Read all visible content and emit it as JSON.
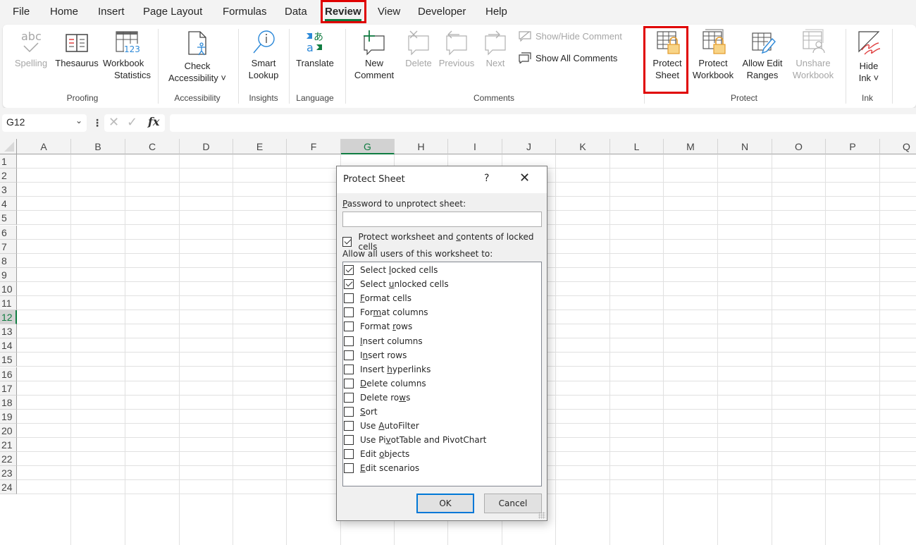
{
  "menu": {
    "tabs": [
      "File",
      "Home",
      "Insert",
      "Page Layout",
      "Formulas",
      "Data",
      "Review",
      "View",
      "Developer",
      "Help"
    ],
    "active_tab": "Review"
  },
  "ribbon": {
    "groups": {
      "proofing": "Proofing",
      "accessibility": "Accessibility",
      "insights": "Insights",
      "language": "Language",
      "comments": "Comments",
      "protect": "Protect",
      "ink": "Ink"
    },
    "buttons": {
      "spelling": "Spelling",
      "thesaurus": "Thesaurus",
      "workbook_statistics_1": "Workbook",
      "workbook_statistics_2": "Statistics",
      "check_accessibility_1": "Check",
      "check_accessibility_2": "Accessibility ˅",
      "smart_lookup_1": "Smart",
      "smart_lookup_2": "Lookup",
      "translate": "Translate",
      "new_comment_1": "New",
      "new_comment_2": "Comment",
      "delete": "Delete",
      "previous": "Previous",
      "next": "Next",
      "show_hide_comment": "Show/Hide Comment",
      "show_all_comments": "Show All Comments",
      "protect_sheet_1": "Protect",
      "protect_sheet_2": "Sheet",
      "protect_workbook_1": "Protect",
      "protect_workbook_2": "Workbook",
      "allow_edit_ranges_1": "Allow Edit",
      "allow_edit_ranges_2": "Ranges",
      "unshare_workbook_1": "Unshare",
      "unshare_workbook_2": "Workbook",
      "hide_ink_1": "Hide",
      "hide_ink_2": "Ink ˅"
    },
    "icons": {
      "abc": "abc",
      "fx": "fx",
      "stats_num": "123"
    }
  },
  "formula_bar": {
    "name_box": "G12",
    "formula": ""
  },
  "sheet": {
    "columns": [
      "A",
      "B",
      "C",
      "D",
      "E",
      "F",
      "G",
      "H",
      "I",
      "J",
      "K",
      "L",
      "M",
      "N",
      "O",
      "P",
      "Q"
    ],
    "rows": [
      "1",
      "2",
      "3",
      "4",
      "5",
      "6",
      "7",
      "8",
      "9",
      "10",
      "11",
      "12",
      "13",
      "14",
      "15",
      "16",
      "17",
      "18",
      "19",
      "20",
      "21",
      "22",
      "23",
      "24"
    ],
    "selected_column": "G",
    "selected_row": "12"
  },
  "dialog": {
    "title": "Protect Sheet",
    "help": "?",
    "close": "✕",
    "password_label_u": "P",
    "password_label_rest": "assword to unprotect sheet:",
    "password_value": "",
    "protect_contents_pre": "Protect worksheet and ",
    "protect_contents_u": "c",
    "protect_contents_post": "ontents of locked cells",
    "protect_contents_checked": true,
    "allow_label": "Allow all users of this worksheet to:",
    "permissions": [
      {
        "pre": "Select ",
        "u": "l",
        "post": "ocked cells",
        "checked": true
      },
      {
        "pre": "Select ",
        "u": "u",
        "post": "nlocked cells",
        "checked": true
      },
      {
        "pre": "",
        "u": "F",
        "post": "ormat cells",
        "checked": false
      },
      {
        "pre": "For",
        "u": "m",
        "post": "at columns",
        "checked": false
      },
      {
        "pre": "Format ",
        "u": "r",
        "post": "ows",
        "checked": false
      },
      {
        "pre": "",
        "u": "I",
        "post": "nsert columns",
        "checked": false
      },
      {
        "pre": "I",
        "u": "n",
        "post": "sert rows",
        "checked": false
      },
      {
        "pre": "Insert ",
        "u": "h",
        "post": "yperlinks",
        "checked": false
      },
      {
        "pre": "",
        "u": "D",
        "post": "elete columns",
        "checked": false
      },
      {
        "pre": "Delete ro",
        "u": "w",
        "post": "s",
        "checked": false
      },
      {
        "pre": "",
        "u": "S",
        "post": "ort",
        "checked": false
      },
      {
        "pre": "Use ",
        "u": "A",
        "post": "utoFilter",
        "checked": false
      },
      {
        "pre": "Use Pi",
        "u": "v",
        "post": "otTable and PivotChart",
        "checked": false
      },
      {
        "pre": "Edit ",
        "u": "o",
        "post": "bjects",
        "checked": false
      },
      {
        "pre": "",
        "u": "E",
        "post": "dit scenarios",
        "checked": false
      }
    ],
    "ok": "OK",
    "cancel": "Cancel"
  },
  "colors": {
    "accent_green": "#107c41",
    "highlight_red": "#e00000",
    "default_button_blue": "#0078d7"
  }
}
